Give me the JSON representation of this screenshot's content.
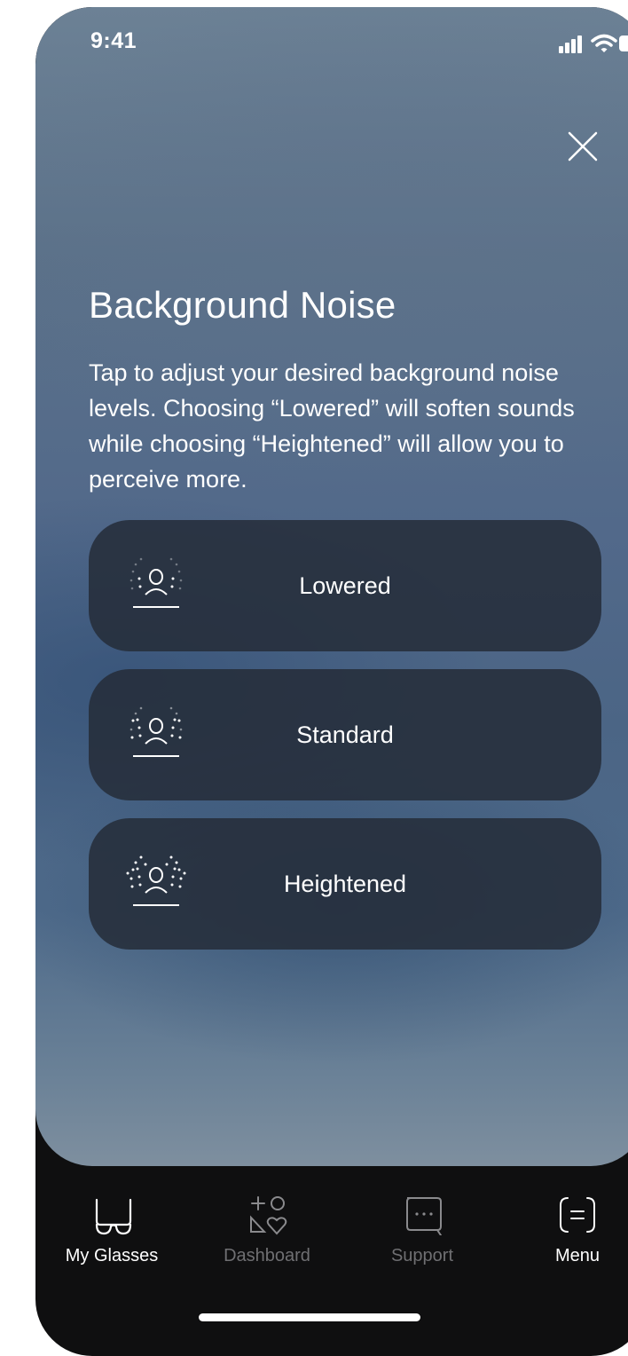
{
  "status_bar": {
    "time": "9:41"
  },
  "modal": {
    "close_icon": "close-icon",
    "title": "Background Noise",
    "description": "Tap to adjust your desired background noise levels. Choosing “Lowered” will soften sounds while choosing “Heightened” will allow you to perceive more."
  },
  "options": [
    {
      "label": "Lowered",
      "icon": "noise-level-low-icon"
    },
    {
      "label": "Standard",
      "icon": "noise-level-standard-icon"
    },
    {
      "label": "Heightened",
      "icon": "noise-level-high-icon"
    }
  ],
  "tab_bar": {
    "tabs": [
      {
        "label": "My Glasses",
        "icon": "glasses-icon",
        "active": true
      },
      {
        "label": "Dashboard",
        "icon": "dashboard-icon",
        "active": false
      },
      {
        "label": "Support",
        "icon": "chat-icon",
        "active": false
      },
      {
        "label": "Menu",
        "icon": "menu-icon",
        "active": true
      }
    ]
  },
  "colors": {
    "option_background": "#262e3a",
    "tab_bar_background": "#0f0f10",
    "inactive_tab_text": "#6f6f72",
    "text": "#ffffff"
  }
}
